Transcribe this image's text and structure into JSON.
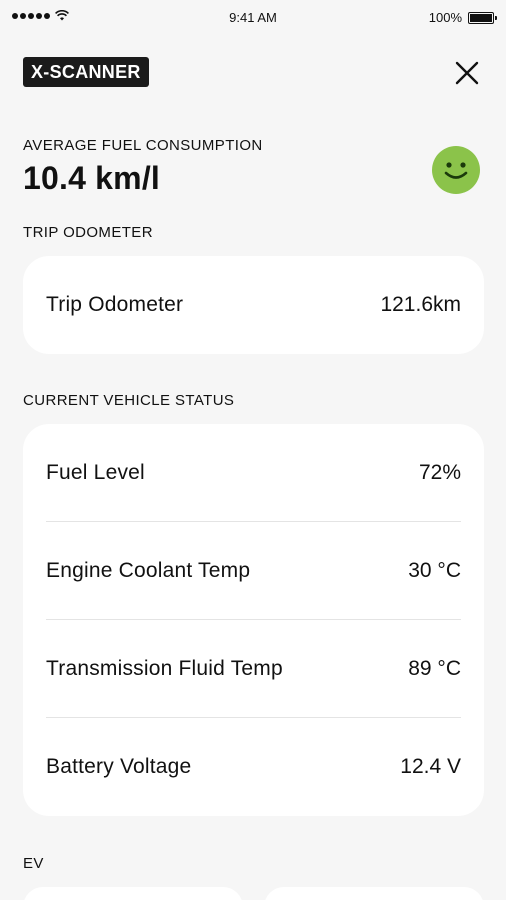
{
  "status_bar": {
    "time": "9:41 AM",
    "battery": "100%",
    "signal_icon": "signal-dots-icon",
    "wifi_icon": "wifi-icon",
    "battery_icon": "battery-icon"
  },
  "header": {
    "brand": "X-SCANNER",
    "close_icon": "close-icon"
  },
  "average": {
    "label": "AVERAGE FUEL CONSUMPTION",
    "value": "10.4 km/l",
    "status_icon": "smiley-face-icon",
    "status_color": "#8bc34a"
  },
  "trip": {
    "section_label": "TRIP ODOMETER",
    "rows": [
      {
        "label": "Trip Odometer",
        "value": "121.6km"
      }
    ]
  },
  "vehicle_status": {
    "section_label": "CURRENT VEHICLE STATUS",
    "rows": [
      {
        "label": "Fuel Level",
        "value": "72%"
      },
      {
        "label": "Engine Coolant Temp",
        "value": "30 °C"
      },
      {
        "label": "Transmission Fluid Temp",
        "value": "89 °C"
      },
      {
        "label": "Battery Voltage",
        "value": "12.4 V"
      }
    ]
  },
  "ev": {
    "section_label": "EV"
  }
}
